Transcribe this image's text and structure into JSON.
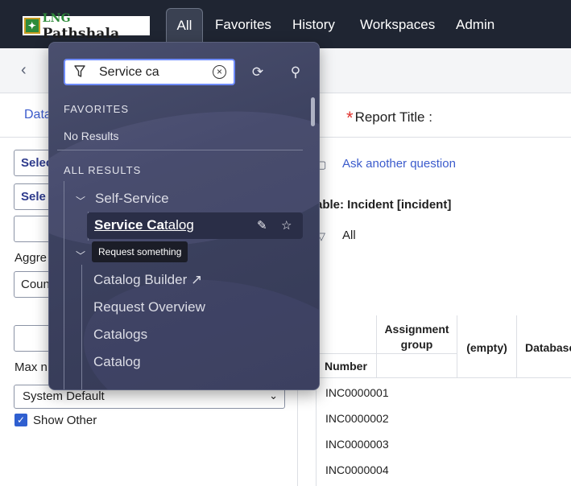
{
  "nav": {
    "logo_text_small": "LNG",
    "logo_text_main": "Pathshala",
    "items": [
      {
        "label": "All"
      },
      {
        "label": "Favorites"
      },
      {
        "label": "History"
      },
      {
        "label": "Workspaces"
      },
      {
        "label": "Admin"
      }
    ]
  },
  "background": {
    "tab_data": "Data",
    "report_title_label": "Report Title :",
    "buttons": [
      "Selec",
      "Sele"
    ],
    "aggregation_label": "Aggre",
    "aggregation_value": "Coun",
    "max_label": "Max n",
    "max_value": "System Default",
    "show_other_label": "Show Other",
    "ask_link": "Ask another question",
    "table_label": "able: Incident [incident]",
    "filter_value": "All",
    "grid": {
      "header_assignment": "Assignment group",
      "header_empty": "(empty)",
      "header_database": "Database",
      "header_number": "Number",
      "rows": [
        "INC0000001",
        "INC0000002",
        "INC0000003",
        "INC0000004"
      ]
    }
  },
  "dropdown": {
    "search_value": "Service ca",
    "search_placeholder": "Filter",
    "favorites_header": "FAVORITES",
    "favorites_empty": "No Results",
    "all_results_header": "ALL RESULTS",
    "groups": [
      {
        "label": "Self-Service"
      }
    ],
    "selected_item": {
      "highlight": "Service Ca",
      "rest": "talog"
    },
    "tooltip": "Request something",
    "items": [
      {
        "label": "Catalog Builder ↗"
      },
      {
        "label": "Request Overview"
      },
      {
        "label": "Catalogs"
      },
      {
        "label": "Catalog"
      }
    ]
  }
}
